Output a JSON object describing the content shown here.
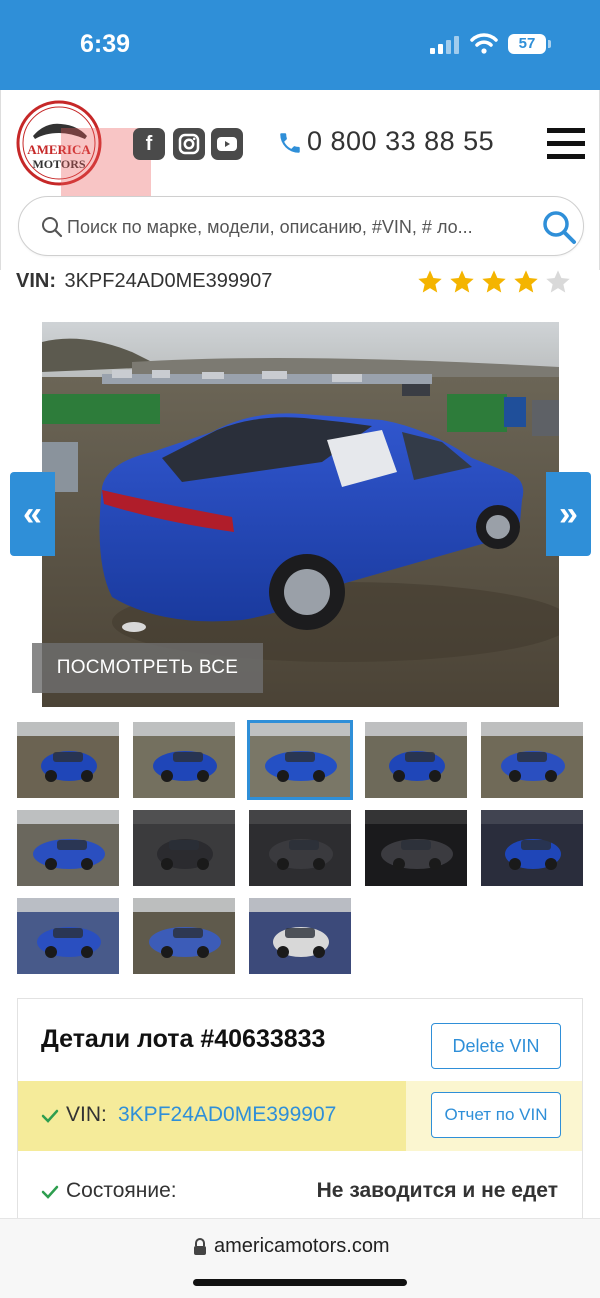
{
  "status_bar": {
    "time": "6:39",
    "battery": "57"
  },
  "header": {
    "logo_text_line1": "AMERICA",
    "logo_text_line2": "MOTORS",
    "social": [
      {
        "name": "facebook",
        "glyph": "f"
      },
      {
        "name": "instagram",
        "glyph": "◎"
      },
      {
        "name": "youtube",
        "glyph": "▶"
      }
    ],
    "phone": "0 800 33 88 55"
  },
  "search": {
    "placeholder": "Поиск по марке, модели, описанию, #VIN, # ло..."
  },
  "vin_row": {
    "label": "VIN:",
    "value": "3KPF24AD0ME399907",
    "rating": 4,
    "rating_max": 5
  },
  "gallery": {
    "view_all": "ПОСМОТРЕТЬ ВСЕ",
    "prev": "«",
    "next": "»",
    "thumbnail_count": 13,
    "active_thumbnail": 3
  },
  "lot": {
    "title": "Детали лота #40633833",
    "delete_vin": "Delete VIN",
    "vin_label": "VIN:",
    "vin_value": "3KPF24AD0ME399907",
    "report_button": "Отчет по VIN",
    "state_label": "Состояние:",
    "state_value": "Не заводится и не едет"
  },
  "browser": {
    "url": "americamotors.com"
  },
  "colors": {
    "accent": "#2f8fd8",
    "band": "#f5eb9a",
    "star": "#f4b400",
    "car": "#1f46b8"
  }
}
